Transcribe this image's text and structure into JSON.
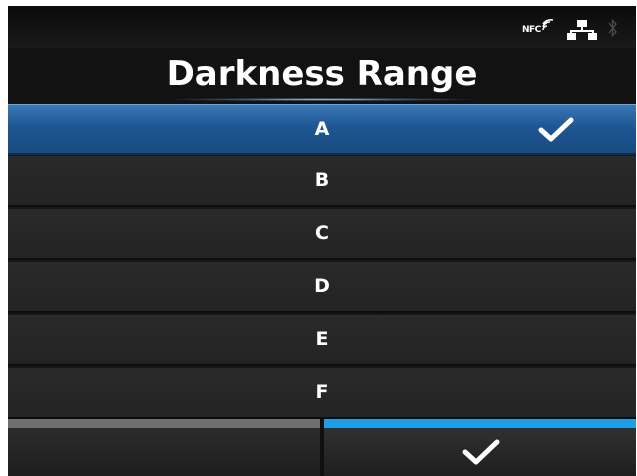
{
  "status_bar": {
    "nfc_label": "NFC",
    "icons": [
      "nfc-icon",
      "network-icon",
      "bluetooth-icon"
    ]
  },
  "header": {
    "title": "Darkness Range"
  },
  "list": {
    "items": [
      {
        "label": "A",
        "selected": true
      },
      {
        "label": "B",
        "selected": false
      },
      {
        "label": "C",
        "selected": false
      },
      {
        "label": "D",
        "selected": false
      },
      {
        "label": "E",
        "selected": false
      },
      {
        "label": "F",
        "selected": false
      }
    ]
  },
  "footer": {
    "back_icon": "back-button",
    "confirm_icon": "checkmark-icon"
  },
  "colors": {
    "selected_row": "#1f5793",
    "confirm_accent": "#1d9ee6",
    "back_accent": "#6e6e6e"
  }
}
